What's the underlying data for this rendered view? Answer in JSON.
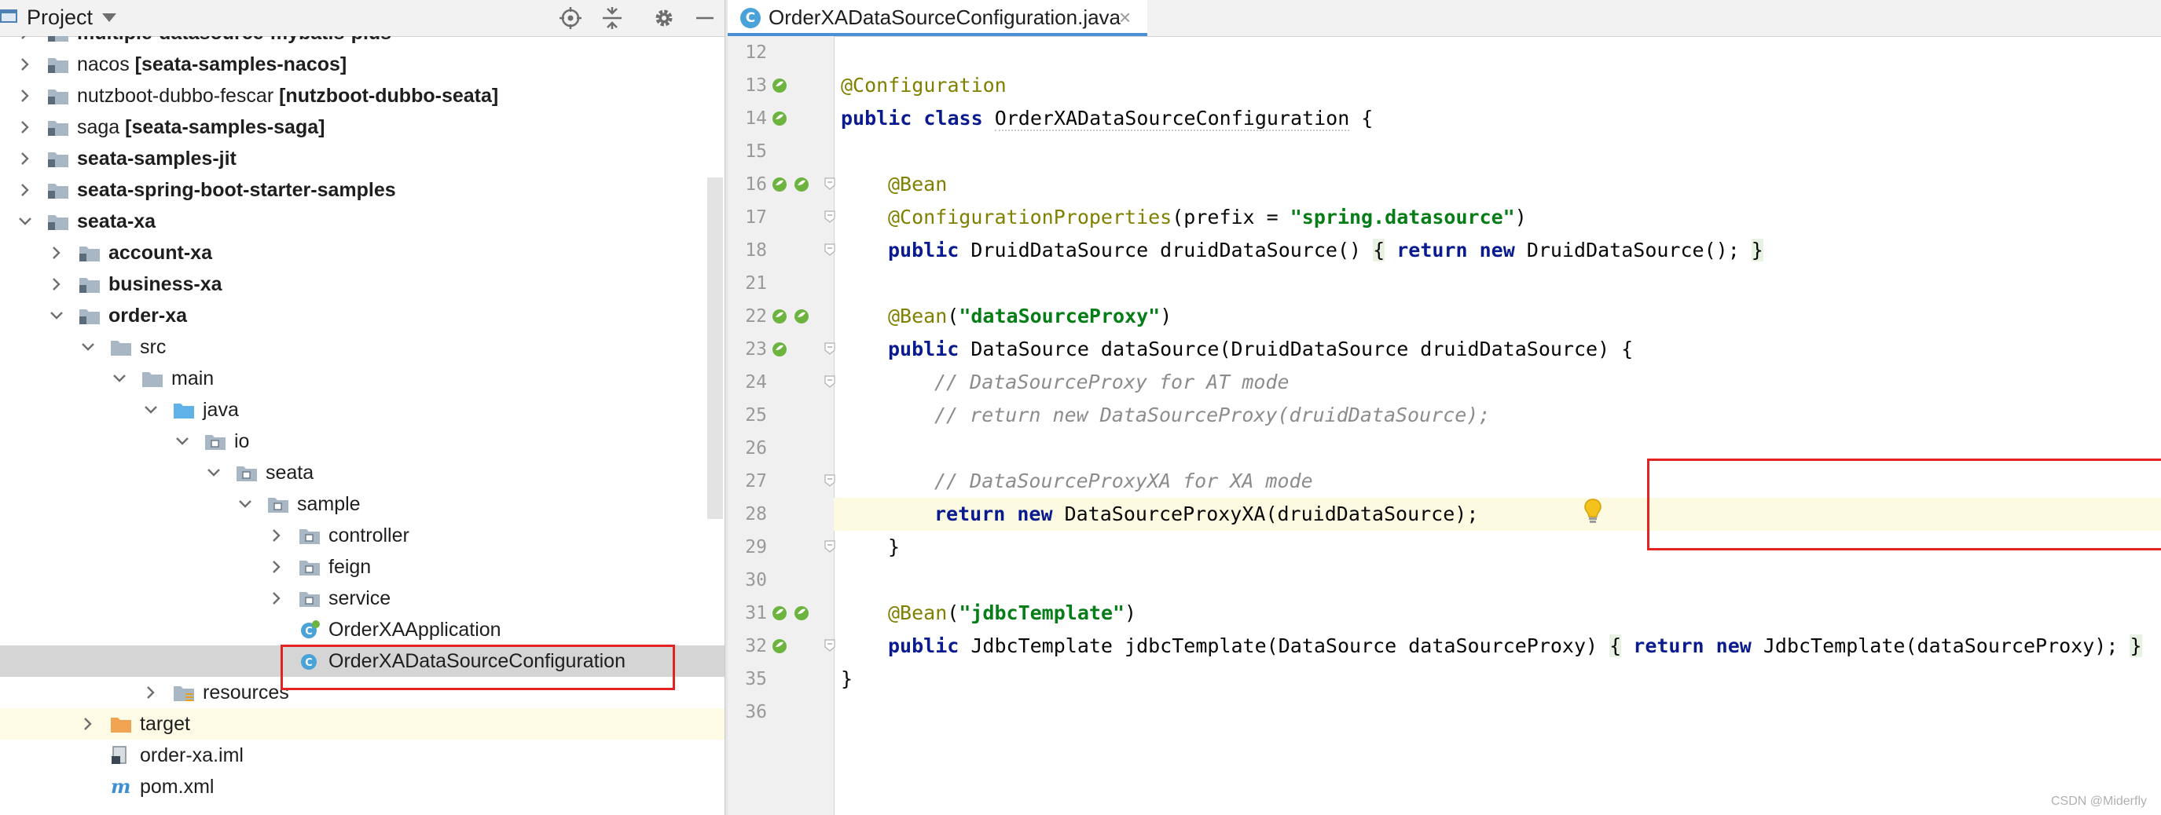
{
  "project_panel": {
    "title": "Project",
    "toolbar": [
      "locate-icon",
      "collapse-all-icon",
      "gear-icon",
      "minimize-icon"
    ],
    "tree": [
      {
        "label": "multiple-datasource-mybatis-plus",
        "suffix": "",
        "bold": true,
        "expanded": false,
        "icon": "module-folder"
      },
      {
        "label": "nacos ",
        "suffix": "[seata-samples-nacos]",
        "bold": false,
        "expanded": false,
        "icon": "module-folder"
      },
      {
        "label": "nutzboot-dubbo-fescar ",
        "suffix": "[nutzboot-dubbo-seata]",
        "bold": false,
        "expanded": false,
        "icon": "module-folder"
      },
      {
        "label": "saga ",
        "suffix": "[seata-samples-saga]",
        "bold": false,
        "expanded": false,
        "icon": "module-folder"
      },
      {
        "label": "seata-samples-jit",
        "suffix": "",
        "bold": true,
        "expanded": false,
        "icon": "module-folder"
      },
      {
        "label": "seata-spring-boot-starter-samples",
        "suffix": "",
        "bold": true,
        "expanded": false,
        "icon": "module-folder"
      },
      {
        "label": "seata-xa",
        "suffix": "",
        "bold": true,
        "expanded": true,
        "icon": "module-folder"
      },
      {
        "label": "account-xa",
        "suffix": "",
        "bold": true,
        "expanded": false,
        "icon": "module-folder"
      },
      {
        "label": "business-xa",
        "suffix": "",
        "bold": true,
        "expanded": false,
        "icon": "module-folder"
      },
      {
        "label": "order-xa",
        "suffix": "",
        "bold": true,
        "expanded": true,
        "icon": "module-folder"
      },
      {
        "label": "src",
        "suffix": "",
        "bold": false,
        "expanded": true,
        "icon": "folder"
      },
      {
        "label": "main",
        "suffix": "",
        "bold": false,
        "expanded": true,
        "icon": "folder"
      },
      {
        "label": "java",
        "suffix": "",
        "bold": false,
        "expanded": true,
        "icon": "source-folder"
      },
      {
        "label": "io",
        "suffix": "",
        "bold": false,
        "expanded": true,
        "icon": "package"
      },
      {
        "label": "seata",
        "suffix": "",
        "bold": false,
        "expanded": true,
        "icon": "package"
      },
      {
        "label": "sample",
        "suffix": "",
        "bold": false,
        "expanded": true,
        "icon": "package"
      },
      {
        "label": "controller",
        "suffix": "",
        "bold": false,
        "expanded": false,
        "icon": "package"
      },
      {
        "label": "feign",
        "suffix": "",
        "bold": false,
        "expanded": false,
        "icon": "package"
      },
      {
        "label": "service",
        "suffix": "",
        "bold": false,
        "expanded": false,
        "icon": "package"
      },
      {
        "label": "OrderXAApplication",
        "suffix": "",
        "bold": false,
        "expanded": null,
        "icon": "spring-class"
      },
      {
        "label": "OrderXADataSourceConfiguration",
        "suffix": "",
        "bold": false,
        "expanded": null,
        "icon": "class",
        "selected": true
      },
      {
        "label": "resources",
        "suffix": "",
        "bold": false,
        "expanded": false,
        "icon": "resources-folder"
      },
      {
        "label": "target",
        "suffix": "",
        "bold": false,
        "expanded": false,
        "icon": "excluded-folder"
      },
      {
        "label": "order-xa.iml",
        "suffix": "",
        "bold": false,
        "expanded": null,
        "icon": "iml-file"
      },
      {
        "label": "pom.xml",
        "suffix": "",
        "bold": false,
        "expanded": null,
        "icon": "maven-file"
      }
    ]
  },
  "editor": {
    "tab": {
      "label": "OrderXADataSourceConfiguration.java",
      "close": "×",
      "icon": "C"
    },
    "line_numbers": [
      "12",
      "13",
      "14",
      "15",
      "16",
      "17",
      "18",
      "21",
      "22",
      "23",
      "24",
      "25",
      "26",
      "27",
      "28",
      "29",
      "30",
      "31",
      "32",
      "35",
      "36"
    ],
    "lines": {
      "l13": {
        "annotation": "@Configuration"
      },
      "l14": {
        "kw1": "public",
        "kw2": "class",
        "name": "OrderXADataSourceConfiguration",
        "rest": " {"
      },
      "l16": {
        "annotation": "@Bean"
      },
      "l17": {
        "annotation": "@ConfigurationProperties",
        "p1": "(prefix = ",
        "str": "\"spring.datasource\"",
        "p2": ")"
      },
      "l18": {
        "kw1": "public",
        "p1": " DruidDataSource druidDataSource() ",
        "b1": "{",
        "kw2": "return",
        "kw3": "new",
        "p2": " DruidDataSource(); ",
        "b2": "}"
      },
      "l22": {
        "annotation": "@Bean",
        "p1": "(",
        "str": "\"dataSourceProxy\"",
        "p2": ")"
      },
      "l23": {
        "kw1": "public",
        "p1": " DataSource dataSource(DruidDataSource druidDataSource) {"
      },
      "l24": {
        "comment": "// DataSourceProxy for AT mode"
      },
      "l25": {
        "comment": "// return new DataSourceProxy(druidDataSource);"
      },
      "l27": {
        "comment": "// DataSourceProxyXA for XA mode"
      },
      "l28": {
        "kw1": "return",
        "kw2": "new",
        "p1": " DataSourceProxyXA(druidDataSource);"
      },
      "l29": {
        "p1": "}"
      },
      "l31": {
        "annotation": "@Bean",
        "p1": "(",
        "str": "\"jdbcTemplate\"",
        "p2": ")"
      },
      "l32": {
        "kw1": "public",
        "p1": " JdbcTemplate jdbcTemplate(DataSource dataSourceProxy) ",
        "b1": "{",
        "kw2": "return",
        "kw3": "new",
        "p2": " JdbcTemplate(dataSourceProxy); ",
        "b2": "}"
      },
      "l35": {
        "p1": "}"
      }
    },
    "watermark": "CSDN @Miderfly"
  },
  "colors": {
    "keyword": "#0a1b8e",
    "annotation": "#808000",
    "string": "#067d17",
    "comment": "#8c8c8c",
    "highlight_box": "#e32222",
    "selected_row": "#d5d5d5"
  }
}
